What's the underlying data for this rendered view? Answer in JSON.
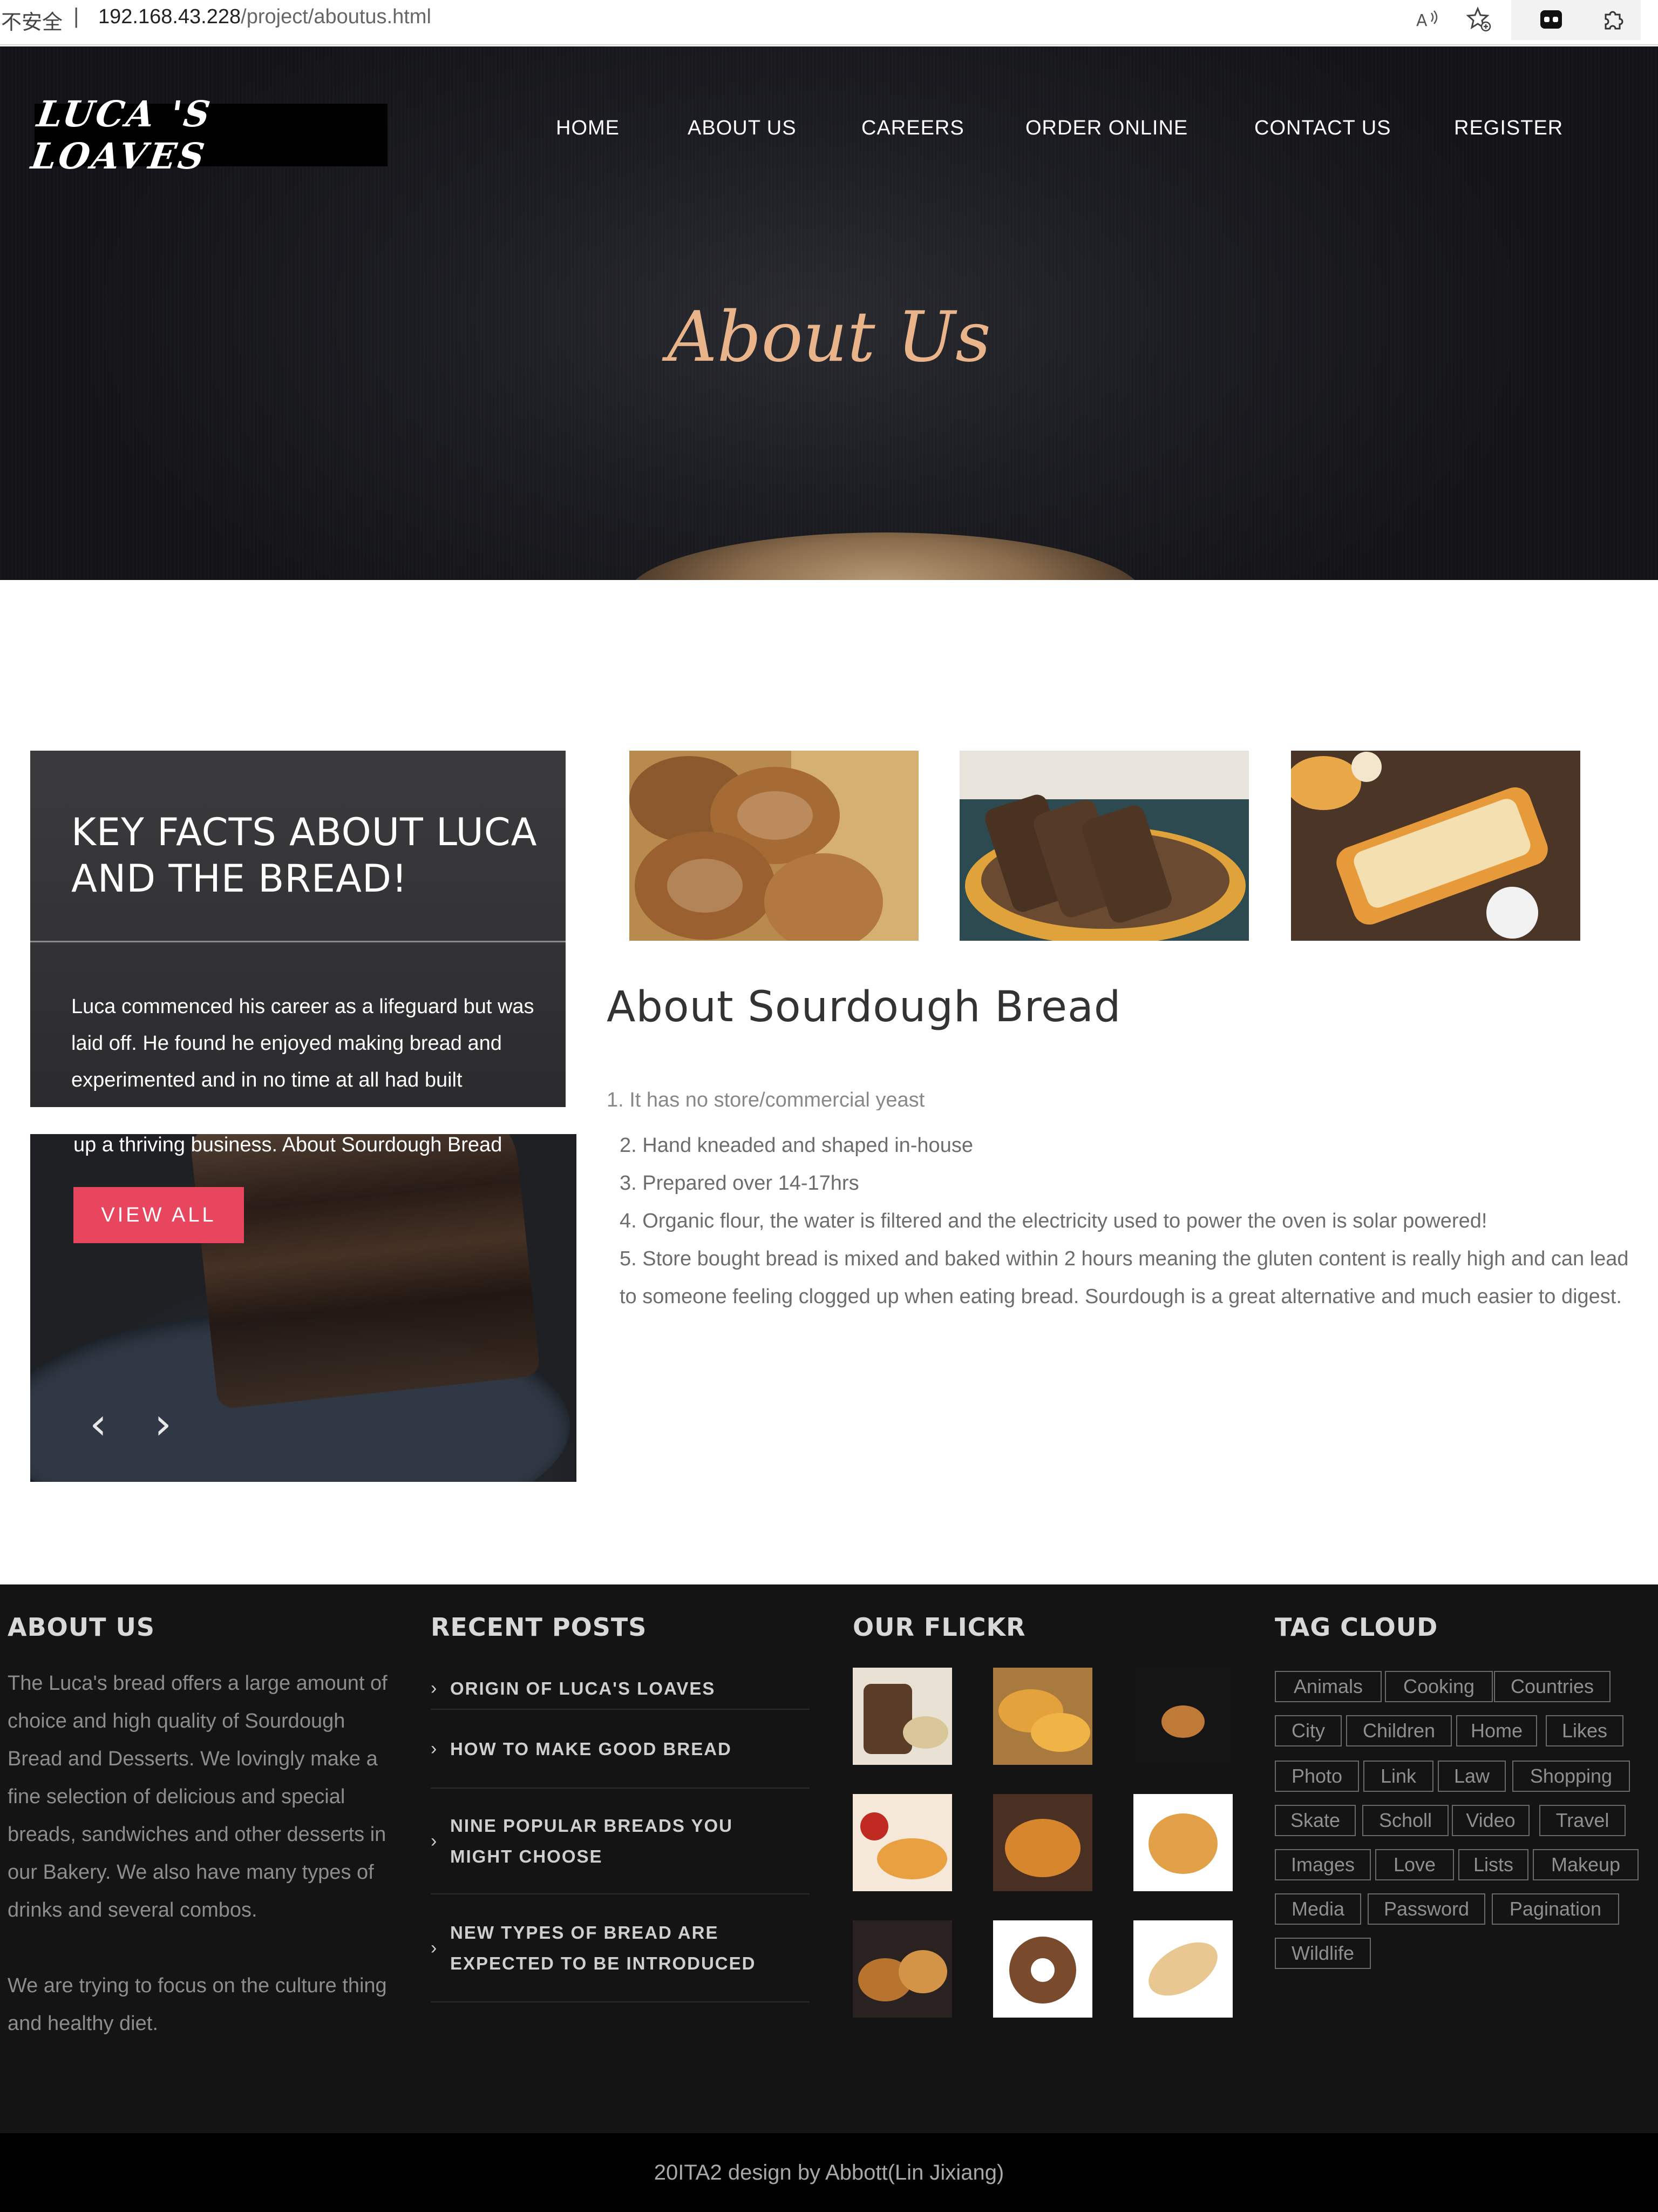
{
  "browser": {
    "insecure_label": "不安全",
    "separator": "|",
    "url_host": "192.168.43.228",
    "url_path": "/project/aboutus.html"
  },
  "header": {
    "logo": "LUCA 'S LOAVES",
    "nav": [
      "HOME",
      "ABOUT US",
      "CAREERS",
      "ORDER ONLINE",
      "CONTACT US",
      "REGISTER"
    ],
    "hero_title": "About Us"
  },
  "facts": {
    "title": "KEY FACTS ABOUT LUCA AND THE BREAD!",
    "text": "Luca commenced his career as a lifeguard but was laid off. He found he enjoyed making bread and experimented and in no time at all had built",
    "text_continued": "up a thriving business. About Sourdough Bread",
    "button": "VIEW ALL",
    "prev_arrow": "‹",
    "next_arrow": "›"
  },
  "about": {
    "heading": "About Sourdough Bread",
    "clipped_item": "1. It has no store/commercial yeast",
    "items": [
      "2. Hand kneaded and shaped in-house",
      "3. Prepared over 14-17hrs",
      "4. Organic flour, the water is filtered and the electricity used to power the oven is solar powered!",
      "5. Store bought bread is mixed and baked within 2 hours meaning the gluten content is really high and can lead to someone feeling clogged up when eating bread. Sourdough is a great alternative and much easier to digest."
    ]
  },
  "footer": {
    "about_heading": "ABOUT US",
    "about_text_1": "The Luca's bread offers a large amount of choice and high quality of Sourdough Bread and Desserts. We lovingly make a fine selection of delicious and special breads, sandwiches and other desserts in our Bakery. We also have many types of drinks and several combos.",
    "about_text_2": "We are trying to focus on the culture thing and healthy diet.",
    "posts_heading": "RECENT POSTS",
    "posts": [
      "ORIGIN OF LUCA'S LOAVES",
      "HOW TO MAKE GOOD BREAD",
      "NINE POPULAR BREADS YOU MIGHT CHOOSE",
      "NEW TYPES OF BREAD ARE EXPECTED TO BE INTRODUCED"
    ],
    "flickr_heading": "OUR FLICKR",
    "tags_heading": "TAG CLOUD",
    "tags": [
      "Animals",
      "Cooking",
      "Countries",
      "City",
      "Children",
      "Home",
      "Likes",
      "Photo",
      "Link",
      "Law",
      "Shopping",
      "Skate",
      "Scholl",
      "Video",
      "Travel",
      "Images",
      "Love",
      "Lists",
      "Makeup",
      "Media",
      "Password",
      "Pagination",
      "Wildlife"
    ],
    "credit": "20ITA2 design by Abbott(Lin Jixiang)"
  },
  "colors": {
    "accent_button": "#e8455f",
    "hero_title": "#e9b48a",
    "footer_bg": "#141414"
  }
}
